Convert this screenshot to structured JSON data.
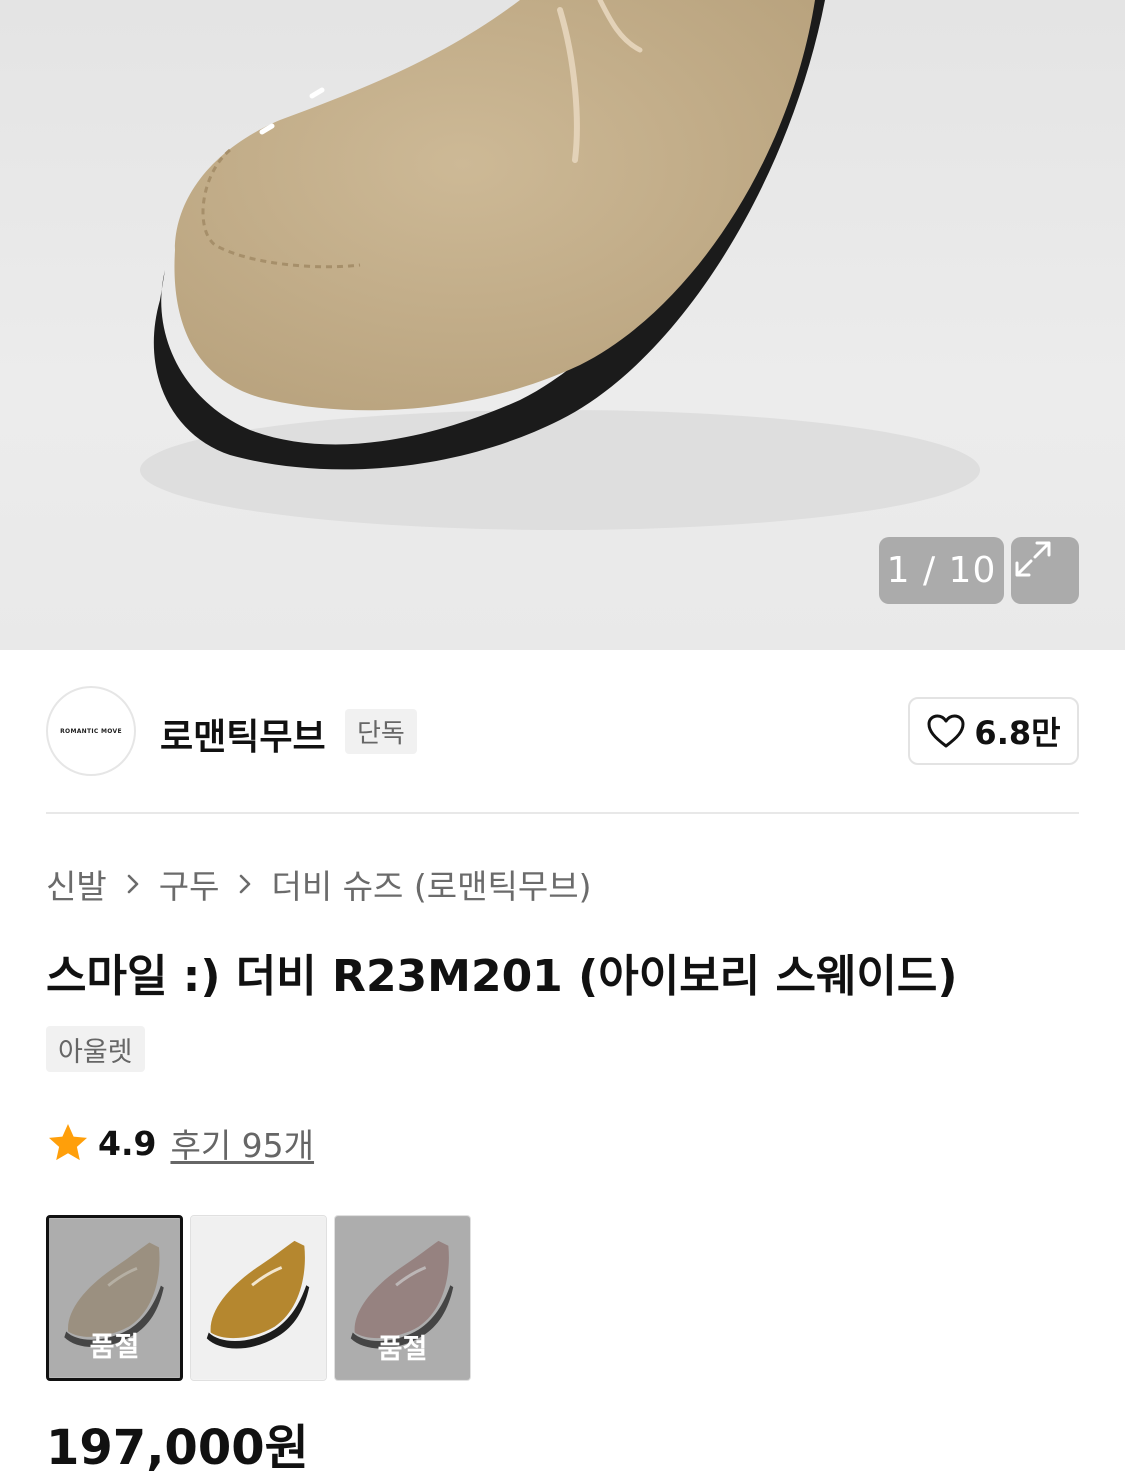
{
  "gallery": {
    "counter": "1 / 10",
    "expand_icon": "expand-icon",
    "image_description_icon": "shoe-photo"
  },
  "brand": {
    "logo_text": "ROMANTIC MOVE",
    "name": "로맨틱무브",
    "tag": "단독",
    "like_count": "6.8만"
  },
  "breadcrumb": {
    "items": [
      "신발",
      "구두",
      "더비 슈즈 (로맨틱무브)"
    ]
  },
  "product": {
    "title": "스마일 :) 더비 R23M201 (아이보리 스웨이드)",
    "chip": "아울렛",
    "rating": "4.9",
    "reviews": "후기 95개",
    "price": "197,000원"
  },
  "options": [
    {
      "color": "#b9a587",
      "soldout": "품절",
      "selected": true
    },
    {
      "color": "#b5872f",
      "soldout": "",
      "selected": false
    },
    {
      "color": "#b08a88",
      "soldout": "품절",
      "selected": false
    }
  ],
  "colors": {
    "star": "#ff9f0a",
    "accent_text": "#111111",
    "muted_text": "#6b6b6b"
  }
}
